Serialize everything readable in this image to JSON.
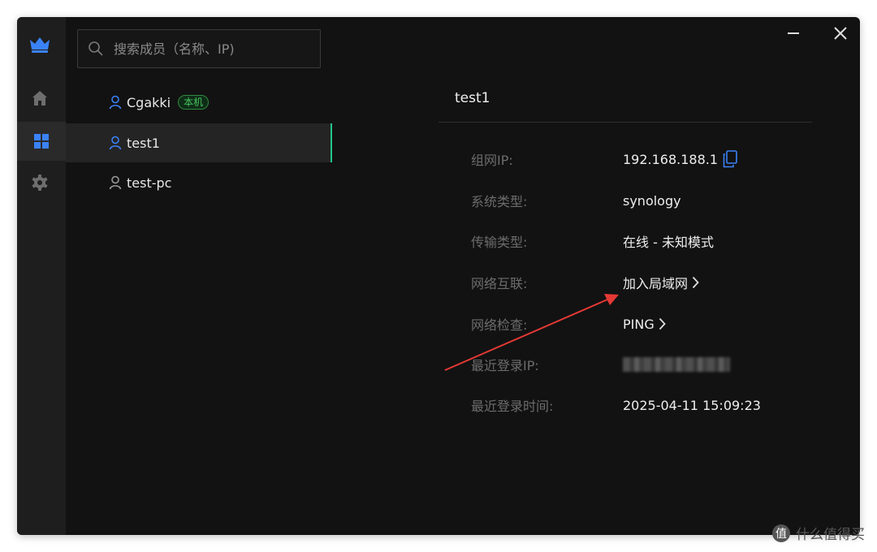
{
  "app": {
    "name": "network-manager",
    "accent": "#3b82f6",
    "online_indicator": "#21c48a"
  },
  "sidebar": {
    "items": [
      {
        "icon": "home-icon",
        "active": false
      },
      {
        "icon": "grid-icon",
        "active": true
      },
      {
        "icon": "gear-icon",
        "active": false
      }
    ]
  },
  "search": {
    "placeholder": "搜索成员（名称、IP)",
    "value": ""
  },
  "members": [
    {
      "name": "Cgakki",
      "badge": "本机",
      "icon": "user-icon",
      "icon_color": "#3b82f6"
    },
    {
      "name": "test1",
      "icon": "user-icon",
      "icon_color": "#3b82f6",
      "selected": true
    },
    {
      "name": "test-pc",
      "icon": "user-icon",
      "icon_color": "#9a9a9a"
    }
  ],
  "detail": {
    "title": "test1",
    "fields": [
      {
        "label": "组网IP:",
        "value": "192.168.188.1",
        "action_icon": "copy-icon"
      },
      {
        "label": "系统类型:",
        "value": "synology"
      },
      {
        "label": "传输类型:",
        "value": "在线 - 未知模式"
      },
      {
        "label": "网络互联:",
        "value": "加入局域网",
        "link_icon": "chevron-right-icon"
      },
      {
        "label": "网络检查:",
        "value": "PING",
        "link_icon": "chevron-right-icon"
      },
      {
        "label": "最近登录IP:",
        "value_obscured": true
      },
      {
        "label": "最近登录时间:",
        "value": "2025-04-11 15:09:23"
      }
    ]
  },
  "window_controls": {
    "minimize_icon": "minimize-icon",
    "close_icon": "close-icon"
  },
  "annotation": {
    "type": "arrow",
    "color": "#e53935"
  },
  "watermark": {
    "icon": "zhi-logo-icon",
    "text": "什么值得买"
  }
}
